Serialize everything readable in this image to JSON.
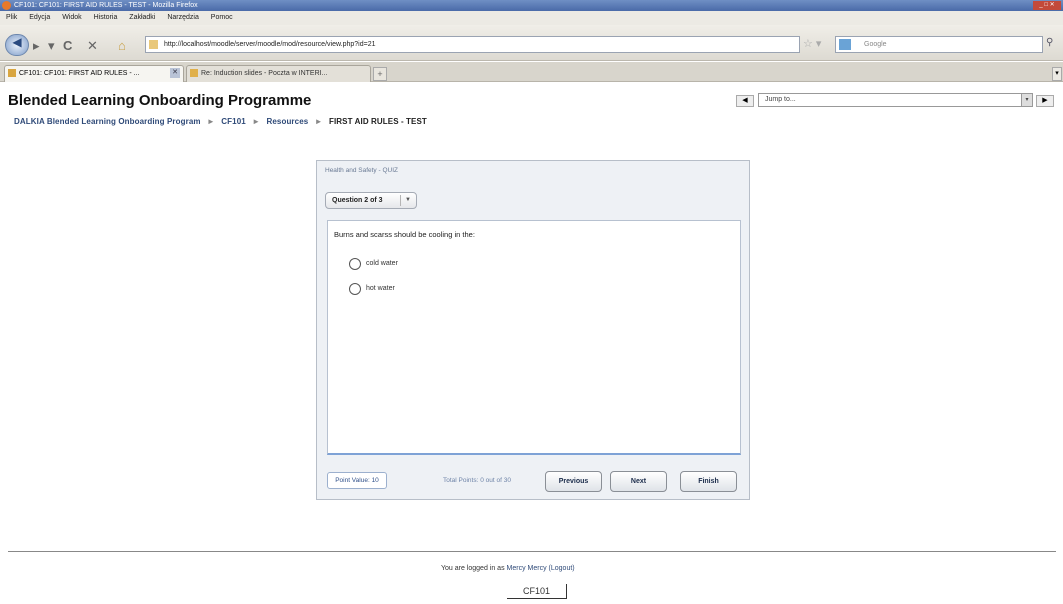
{
  "browser": {
    "window_title": "CF101: CF101: FIRST AID RULES - TEST - Mozilla Firefox",
    "menu": [
      "Plik",
      "Edycja",
      "Widok",
      "Historia",
      "Zakładki",
      "Narzędzia",
      "Pomoc"
    ],
    "url": "http://localhost/moodle/server/moodle/mod/resource/view.php?id=21",
    "search_placeholder": "Google",
    "tabs": [
      {
        "label": "CF101: CF101: FIRST AID RULES - ..."
      },
      {
        "label": "Re: Induction slides - Poczta w INTERI..."
      }
    ]
  },
  "page": {
    "site_title": "Blended Learning Onboarding Programme",
    "jump_to": "Jump to...",
    "breadcrumb": [
      "DALKIA Blended Learning Onboarding Program",
      "CF101",
      "Resources",
      "FIRST AID RULES - TEST"
    ],
    "breadcrumb_sep": "►"
  },
  "quiz": {
    "header": "Health and Safety - QUIZ",
    "question_selector": "Question 2 of 3",
    "question_text": "Burns and scarss should be cooling in the:",
    "options": [
      "cold water",
      "hot water"
    ],
    "point_value": "Point Value: 10",
    "total_points": "Total Points: 0 out of 30",
    "buttons": {
      "previous": "Previous",
      "next": "Next",
      "finish": "Finish"
    }
  },
  "footer": {
    "logged_in_prefix": "You are logged in as",
    "user": "Mercy Mercy",
    "logout": "(Logout)",
    "course": "CF101"
  }
}
